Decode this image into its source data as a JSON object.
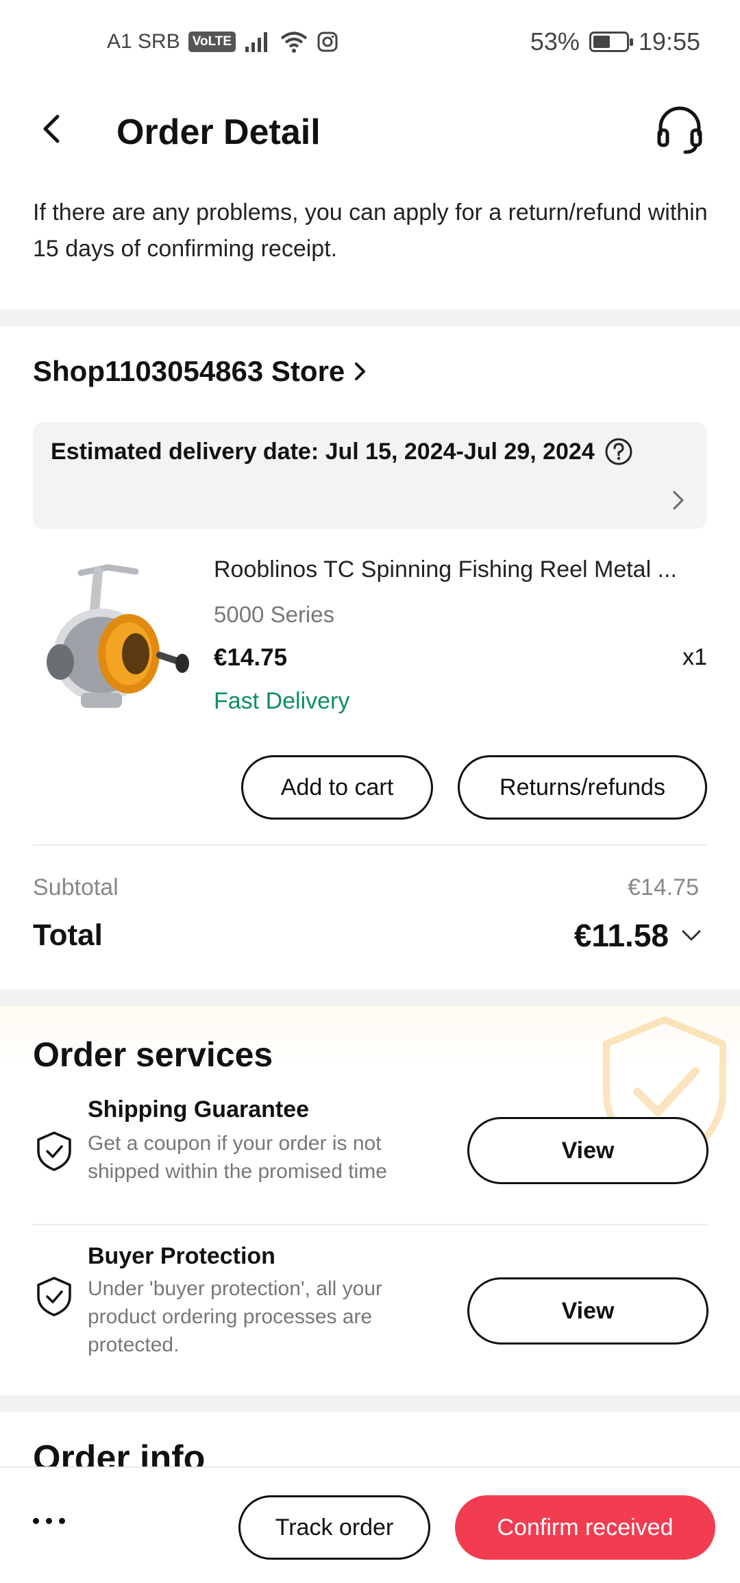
{
  "status_bar": {
    "carrier": "A1 SRB",
    "volte": "VoLTE",
    "battery_percent": "53%",
    "battery_level": 0.53,
    "time": "19:55"
  },
  "header": {
    "title": "Order Detail",
    "back_icon": "chevron-left-icon",
    "support_icon": "headset-icon"
  },
  "notice": {
    "text": "If there are any problems, you can apply for a return/refund within 15 days of confirming receipt."
  },
  "shop": {
    "name": "Shop1103054863 Store",
    "estimated_delivery": "Estimated delivery date: Jul 15, 2024-Jul 29, 2024"
  },
  "product": {
    "title": "Rooblinos TC Spinning Fishing Reel Metal ...",
    "variant": "5000 Series",
    "price": "€14.75",
    "quantity": "x1",
    "delivery_tag": "Fast Delivery",
    "add_to_cart_label": "Add to cart",
    "returns_label": "Returns/refunds"
  },
  "summary": {
    "subtotal_label": "Subtotal",
    "subtotal_value": "€14.75",
    "total_label": "Total",
    "total_value": "€11.58"
  },
  "services": {
    "title": "Order services",
    "items": [
      {
        "title": "Shipping Guarantee",
        "description": "Get a coupon if your order is not shipped within the promised time",
        "button": "View"
      },
      {
        "title": "Buyer Protection",
        "description": "Under 'buyer protection', all your product ordering processes are protected.",
        "button": "View"
      }
    ]
  },
  "order_info": {
    "title": "Order info"
  },
  "bottom_bar": {
    "track_label": "Track order",
    "confirm_label": "Confirm received"
  },
  "colors": {
    "accent": "#f23c50",
    "fast_delivery": "#0e8f5f",
    "watermark": "#f5b54a"
  }
}
